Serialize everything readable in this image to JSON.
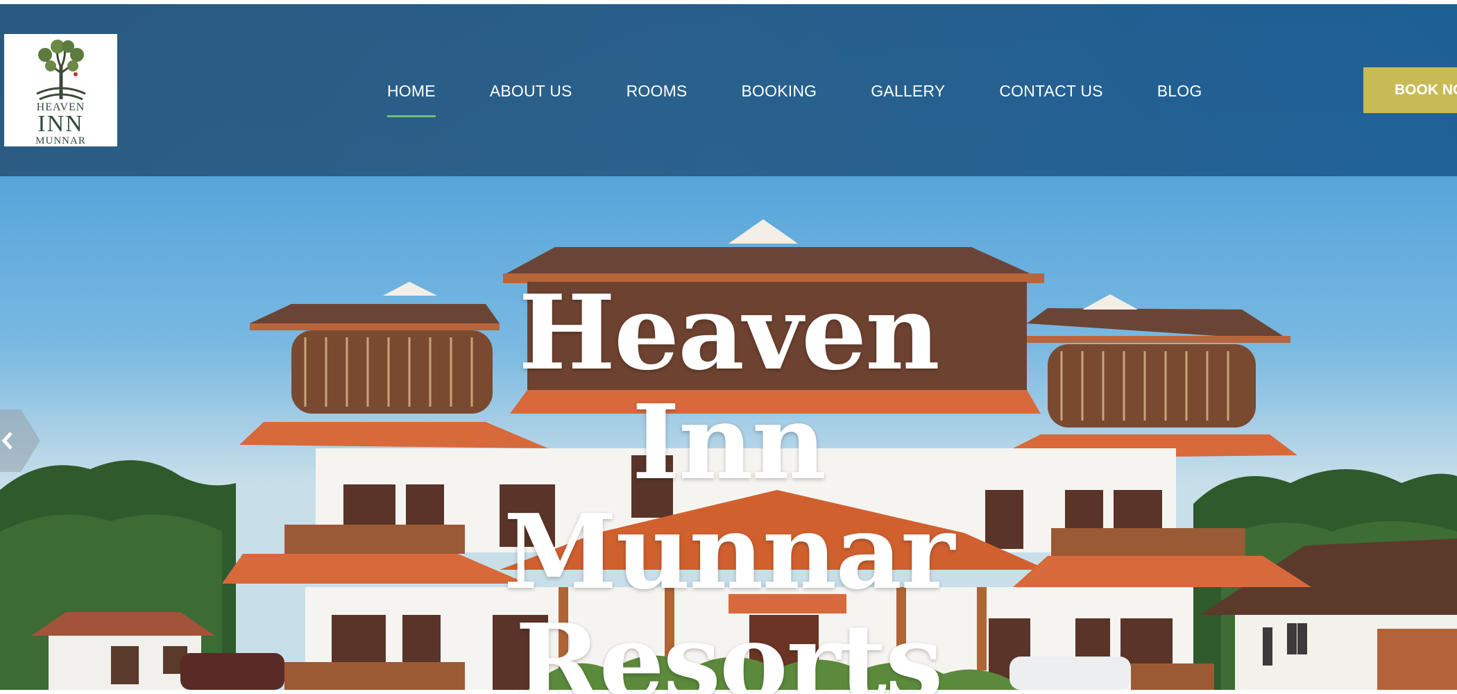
{
  "brand": {
    "logo_line1": "HEAVEN",
    "logo_line2": "INN",
    "logo_line3": "MUNNAR",
    "accent_color": "#c8bb55",
    "active_underline_color": "#6fbf7a"
  },
  "nav": {
    "items": [
      {
        "label": "HOME",
        "active": true
      },
      {
        "label": "ABOUT US",
        "active": false
      },
      {
        "label": "ROOMS",
        "active": false
      },
      {
        "label": "BOOKING",
        "active": false
      },
      {
        "label": "GALLERY",
        "active": false
      },
      {
        "label": "CONTACT US",
        "active": false
      },
      {
        "label": "BLOG",
        "active": false
      }
    ],
    "book_button": "BOOK NOW"
  },
  "hero": {
    "title_line1": "Heaven Inn",
    "title_line2": "Munnar",
    "title_line3": "Resorts",
    "prev_icon": "chevron-left-icon"
  }
}
